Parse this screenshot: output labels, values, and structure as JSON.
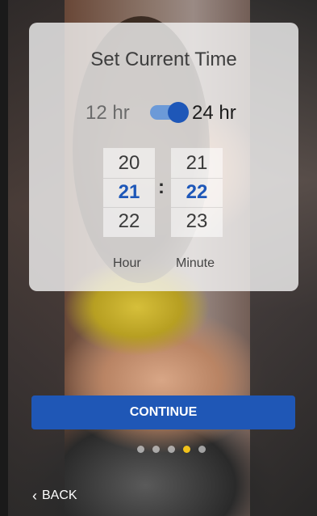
{
  "title": "Set Current Time",
  "format_toggle": {
    "left_label": "12 hr",
    "right_label": "24 hr",
    "selected": "24 hr"
  },
  "pickers": {
    "hour": {
      "prev": "20",
      "selected": "21",
      "next": "22",
      "label": "Hour"
    },
    "minute": {
      "prev": "21",
      "selected": "22",
      "next": "23",
      "label": "Minute"
    },
    "separator": ":"
  },
  "continue_label": "CONTINUE",
  "back_label": "BACK",
  "pagination": {
    "count": 5,
    "active_index": 3
  },
  "colors": {
    "accent": "#1f57b6",
    "active_dot": "#f2c21b"
  }
}
